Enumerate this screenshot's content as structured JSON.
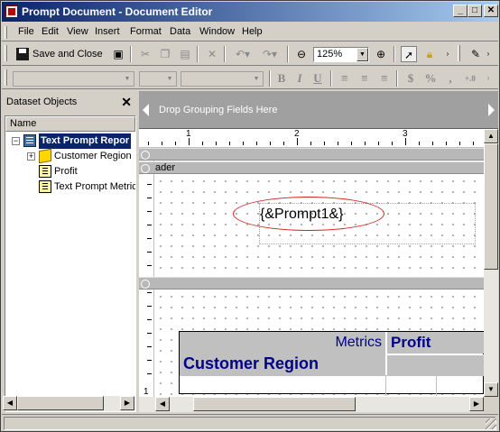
{
  "window": {
    "title": "Prompt Document - Document Editor",
    "minimize": "_",
    "maximize": "□",
    "close": "✕"
  },
  "menu": {
    "items": [
      {
        "label": "File"
      },
      {
        "label": "Edit"
      },
      {
        "label": "View"
      },
      {
        "label": "Insert"
      },
      {
        "label": "Format"
      },
      {
        "label": "Data"
      },
      {
        "label": "Window"
      },
      {
        "label": "Help"
      }
    ]
  },
  "toolbar": {
    "save_and_close": "Save and Close",
    "zoom": "125%",
    "icons": [
      "save-icon",
      "cut-icon",
      "copy-icon",
      "paste-icon",
      "delete-icon",
      "undo-icon",
      "redo-icon",
      "zoom-out-icon",
      "zoom-in-icon",
      "pointer-icon",
      "lock-icon",
      "pin-icon"
    ]
  },
  "format_toolbar": {
    "bold": "B",
    "italic": "I",
    "underline": "U",
    "currency": "$",
    "percent": "%",
    "comma": ",",
    "decimal": "+.0"
  },
  "left_panel": {
    "title": "Dataset Objects",
    "close": "✕",
    "column_header": "Name",
    "tree": [
      {
        "label": "Text Prompt Repor",
        "type": "report",
        "expander": "−",
        "selected": true
      },
      {
        "label": "Customer Region",
        "type": "attribute",
        "expander": "+"
      },
      {
        "label": "Profit",
        "type": "metric"
      },
      {
        "label": "Text Prompt Metric",
        "type": "metric"
      }
    ]
  },
  "design": {
    "grouping_placeholder": "Drop Grouping Fields Here",
    "ruler_numbers": [
      "1",
      "2",
      "3"
    ],
    "vruler_number": "1",
    "section_header_label": "ader",
    "prompt_text": "{&Prompt1&}",
    "grid": {
      "metrics_label": "Metrics",
      "profit_label": "Profit",
      "region_label": "Customer Region"
    }
  },
  "colors": {
    "title_start": "#0a246a",
    "title_end": "#a6caf0",
    "grid_text": "#00008b",
    "oval": "#d02020"
  }
}
